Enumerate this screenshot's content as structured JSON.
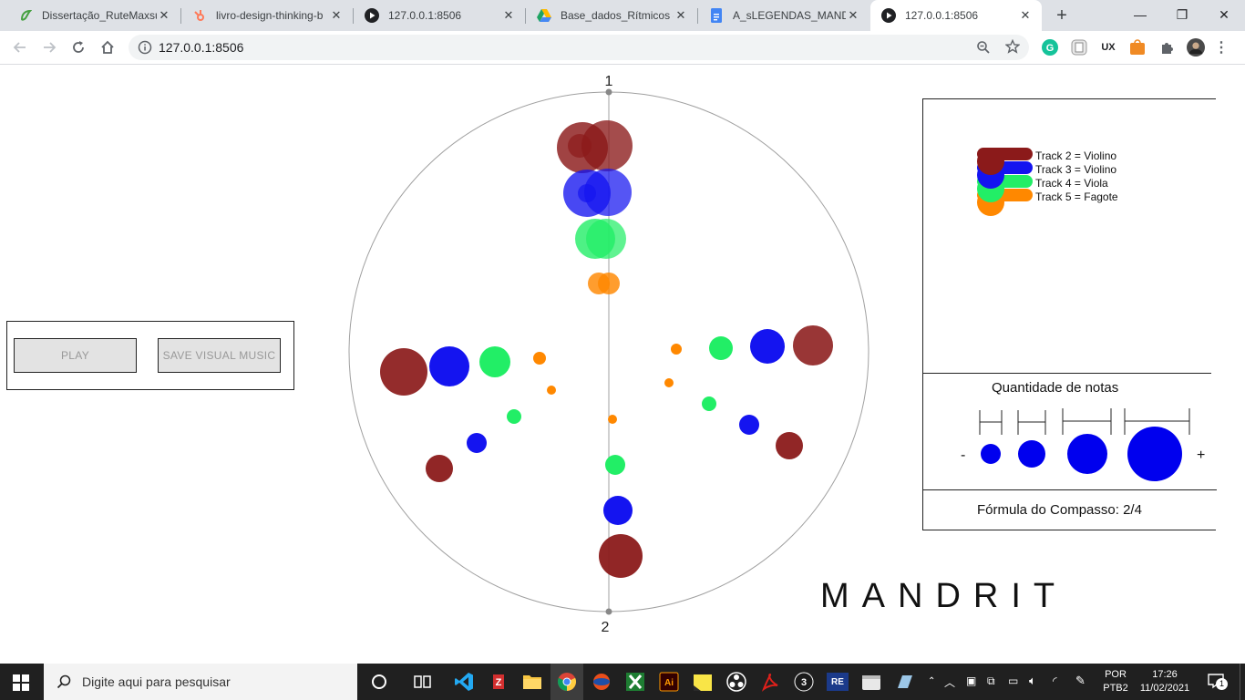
{
  "browser": {
    "tabs": [
      {
        "title": "Dissertação_RuteMaxsu",
        "favicon": "overleaf-icon",
        "color": "#47a141"
      },
      {
        "title": "livro-design-thinking-b",
        "favicon": "hubspot-icon",
        "color": "#ff7a59"
      },
      {
        "title": "127.0.0.1:8506",
        "favicon": "play-icon",
        "color": "#202124"
      },
      {
        "title": "Base_dados_Rítmicos -",
        "favicon": "google-drive-icon",
        "color": "#1fa463"
      },
      {
        "title": "A_sLEGENDAS_MANDR",
        "favicon": "google-docs-icon",
        "color": "#4285f4"
      },
      {
        "title": "127.0.0.1:8506",
        "favicon": "play-icon",
        "color": "#202124"
      }
    ],
    "url": "127.0.0.1:8506"
  },
  "app": {
    "play_label": "PLAY",
    "save_label": "SAVE VISUAL MUSIC",
    "beat_labels": [
      "1",
      "2"
    ],
    "legend": [
      {
        "label": "Track 2 = Violino",
        "color": "#8b1a1a"
      },
      {
        "label": "Track 3 = Violino",
        "color": "#1414f0"
      },
      {
        "label": "Track 4 = Viola",
        "color": "#22ee66"
      },
      {
        "label": "Track 5 = Fagote",
        "color": "#ff8800"
      }
    ],
    "quantity_title": "Quantidade de notas",
    "quantity_minus": "-",
    "quantity_plus": "+",
    "formula": "Fórmula do Compasso: 2/4",
    "logo": "MANDRIT"
  },
  "taskbar": {
    "search_placeholder": "Digite aqui para pesquisar",
    "language": "POR",
    "layout": "PTB2",
    "time": "17:26",
    "date": "11/02/2021",
    "notifications": "1"
  }
}
